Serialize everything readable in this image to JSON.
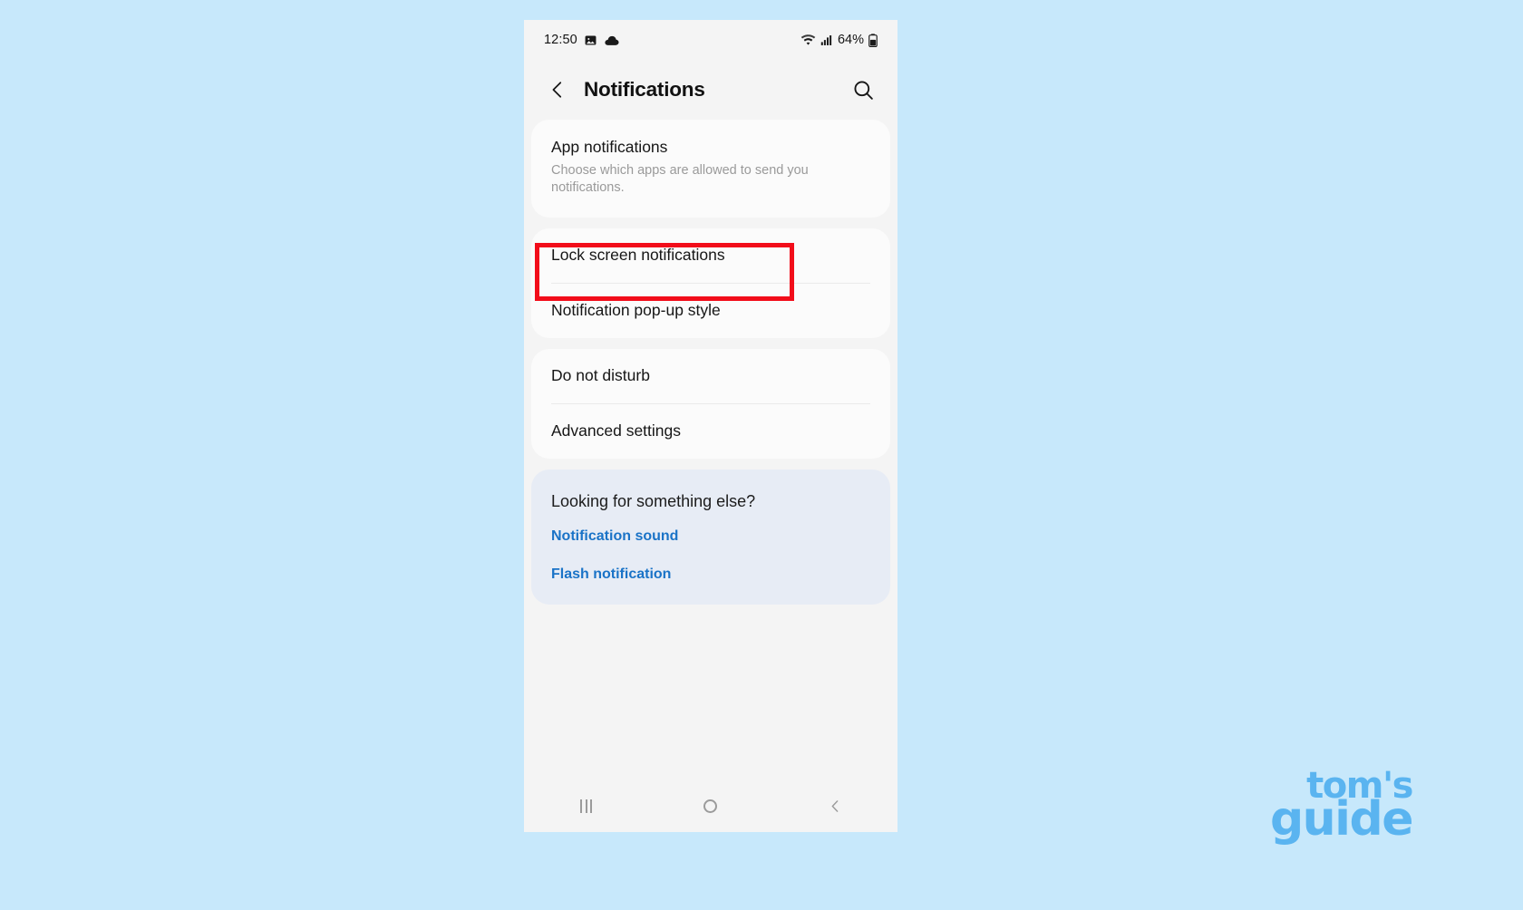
{
  "background_color": "#c7e8fb",
  "phone": {
    "status_bar": {
      "time": "12:50",
      "left_icons": [
        "image-icon",
        "cloud-icon"
      ],
      "right_icons": [
        "wifi-icon",
        "cellular-signal-icon"
      ],
      "battery_percent": "64%",
      "battery_icon": "battery-icon"
    },
    "header": {
      "back_icon": "chevron-left-icon",
      "title": "Notifications",
      "search_icon": "search-icon"
    },
    "sections": [
      {
        "id": "app-notifications",
        "rows": [
          {
            "title": "App notifications",
            "subtitle": "Choose which apps are allowed to send you notifications."
          }
        ]
      },
      {
        "id": "notification-display",
        "rows": [
          {
            "title": "Lock screen notifications",
            "subtitle": ""
          },
          {
            "title": "Notification pop-up style",
            "subtitle": ""
          }
        ]
      },
      {
        "id": "other-settings",
        "rows": [
          {
            "title": "Do not disturb",
            "subtitle": ""
          },
          {
            "title": "Advanced settings",
            "subtitle": ""
          }
        ]
      }
    ],
    "looking_for": {
      "heading": "Looking for something else?",
      "links": [
        {
          "label": "Notification sound"
        },
        {
          "label": "Flash notification"
        }
      ],
      "link_color": "#1a73c7",
      "card_color": "#e7ecf5"
    },
    "nav_bar": {
      "recents_icon": "recents-lines-icon",
      "home_icon": "home-circle-icon",
      "back_icon": "back-chevron-icon"
    }
  },
  "annotation": {
    "highlight_target": "Lock screen notifications",
    "highlight_color": "#f20d1a"
  },
  "watermark": {
    "line1": "tom's",
    "line2": "guide",
    "color": "#5ab4f0"
  }
}
